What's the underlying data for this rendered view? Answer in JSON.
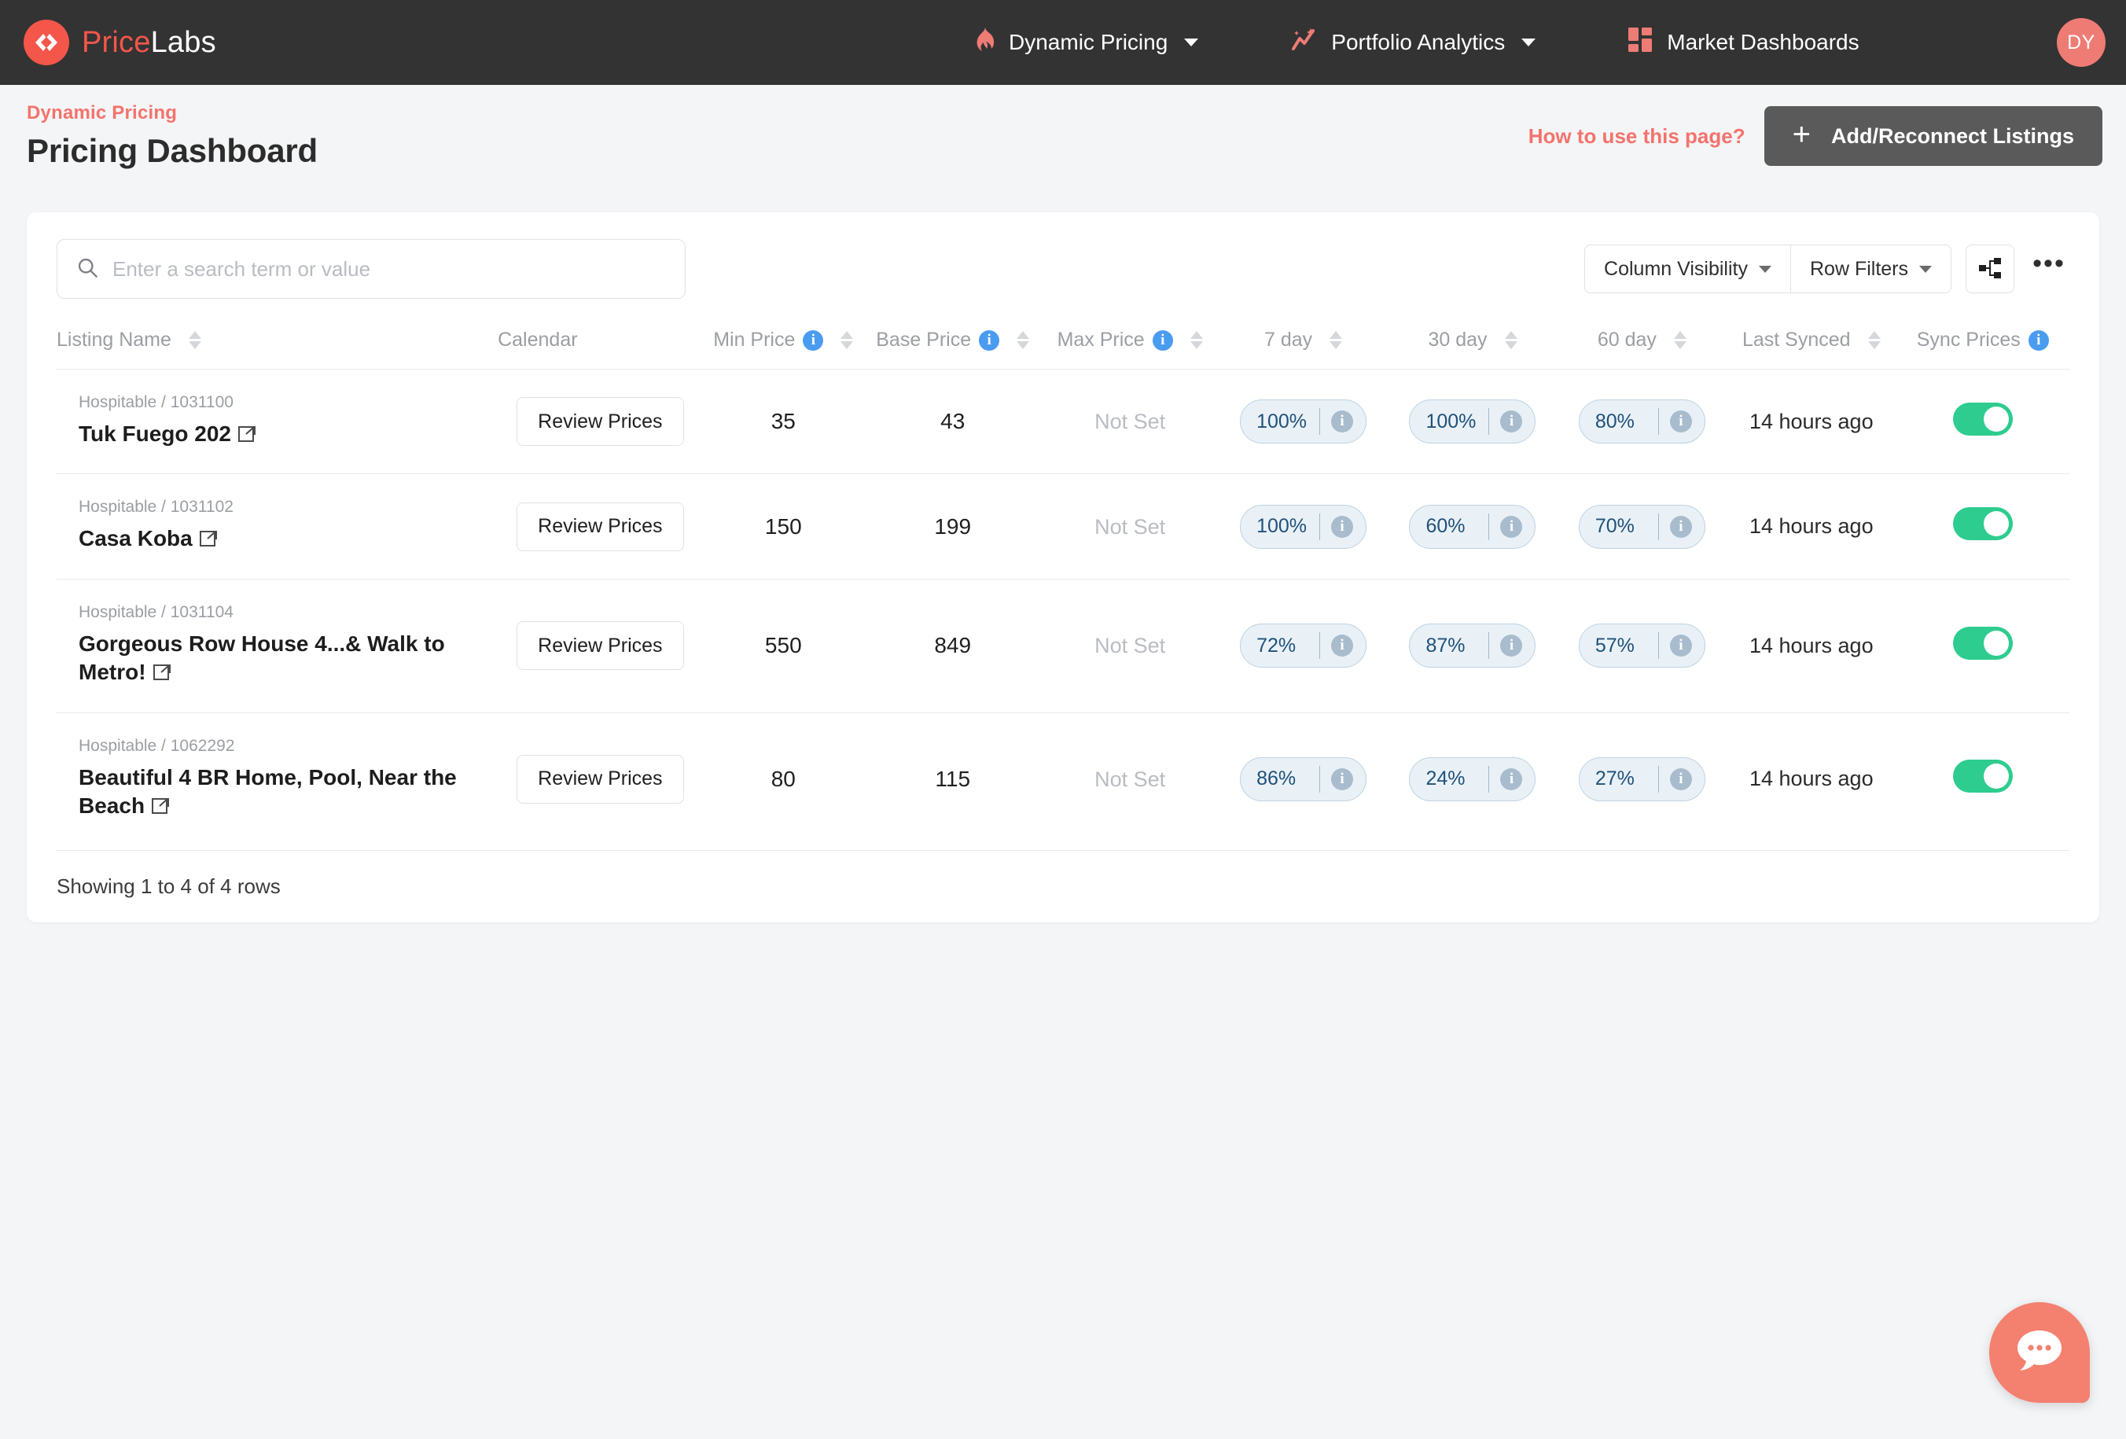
{
  "brand": {
    "part1": "Price",
    "part2": "Labs"
  },
  "nav": {
    "items": [
      {
        "label": "Dynamic Pricing",
        "icon": "flame-icon",
        "has_caret": true
      },
      {
        "label": "Portfolio Analytics",
        "icon": "analytics-sparkle-icon",
        "has_caret": true
      },
      {
        "label": "Market Dashboards",
        "icon": "grid-squares-icon",
        "has_caret": false
      }
    ],
    "avatar_initials": "DY"
  },
  "header": {
    "breadcrumb": "Dynamic Pricing",
    "title": "Pricing Dashboard",
    "how_to_label": "How to use this page?",
    "add_button_label": "Add/Reconnect Listings",
    "plus": "+"
  },
  "toolbar": {
    "search_placeholder": "Enter a search term or value",
    "search_value": "",
    "column_visibility_label": "Column Visibility",
    "row_filters_label": "Row Filters",
    "share_icon": "share-nodes-icon",
    "more_label": "•••"
  },
  "table": {
    "columns": [
      {
        "label": "Listing Name",
        "info": false,
        "sortable": true,
        "align": "left"
      },
      {
        "label": "Calendar",
        "info": false,
        "sortable": false,
        "align": "left"
      },
      {
        "label": "Min Price",
        "info": true,
        "sortable": true,
        "align": "center"
      },
      {
        "label": "Base Price",
        "info": true,
        "sortable": true,
        "align": "center"
      },
      {
        "label": "Max Price",
        "info": true,
        "sortable": true,
        "align": "center"
      },
      {
        "label": "7 day",
        "info": false,
        "sortable": true,
        "align": "center"
      },
      {
        "label": "30 day",
        "info": false,
        "sortable": true,
        "align": "center"
      },
      {
        "label": "60 day",
        "info": false,
        "sortable": true,
        "align": "center"
      },
      {
        "label": "Last Synced",
        "info": false,
        "sortable": true,
        "align": "center"
      },
      {
        "label": "Sync Prices",
        "info": true,
        "sortable": false,
        "align": "center"
      }
    ],
    "review_label": "Review Prices",
    "not_set_label": "Not Set",
    "rows": [
      {
        "source_id": "Hospitable / 1031100",
        "name": "Tuk Fuego 202",
        "min_price": "35",
        "base_price": "43",
        "max_price": "Not Set",
        "d7": "100%",
        "d30": "100%",
        "d60": "80%",
        "last_synced": "14 hours ago",
        "sync_on": true
      },
      {
        "source_id": "Hospitable / 1031102",
        "name": "Casa Koba",
        "min_price": "150",
        "base_price": "199",
        "max_price": "Not Set",
        "d7": "100%",
        "d30": "60%",
        "d60": "70%",
        "last_synced": "14 hours ago",
        "sync_on": true
      },
      {
        "source_id": "Hospitable / 1031104",
        "name": "Gorgeous Row House 4...& Walk to Metro!",
        "min_price": "550",
        "base_price": "849",
        "max_price": "Not Set",
        "d7": "72%",
        "d30": "87%",
        "d60": "57%",
        "last_synced": "14 hours ago",
        "sync_on": true
      },
      {
        "source_id": "Hospitable / 1062292",
        "name": "Beautiful 4 BR Home, Pool, Near the Beach",
        "min_price": "80",
        "base_price": "115",
        "max_price": "Not Set",
        "d7": "86%",
        "d30": "24%",
        "d60": "27%",
        "last_synced": "14 hours ago",
        "sync_on": true
      }
    ],
    "footer": "Showing 1 to 4 of 4 rows"
  },
  "chat": {
    "icon": "chat-bubble-icon"
  },
  "colors": {
    "brand_coral": "#f4564a",
    "nav_bg": "#333333",
    "accent_link": "#f4736c",
    "toggle_on": "#2ecc8f",
    "info_blue": "#4a9cf0",
    "pill_bg": "#e9f1f7",
    "pill_text": "#20517a"
  }
}
